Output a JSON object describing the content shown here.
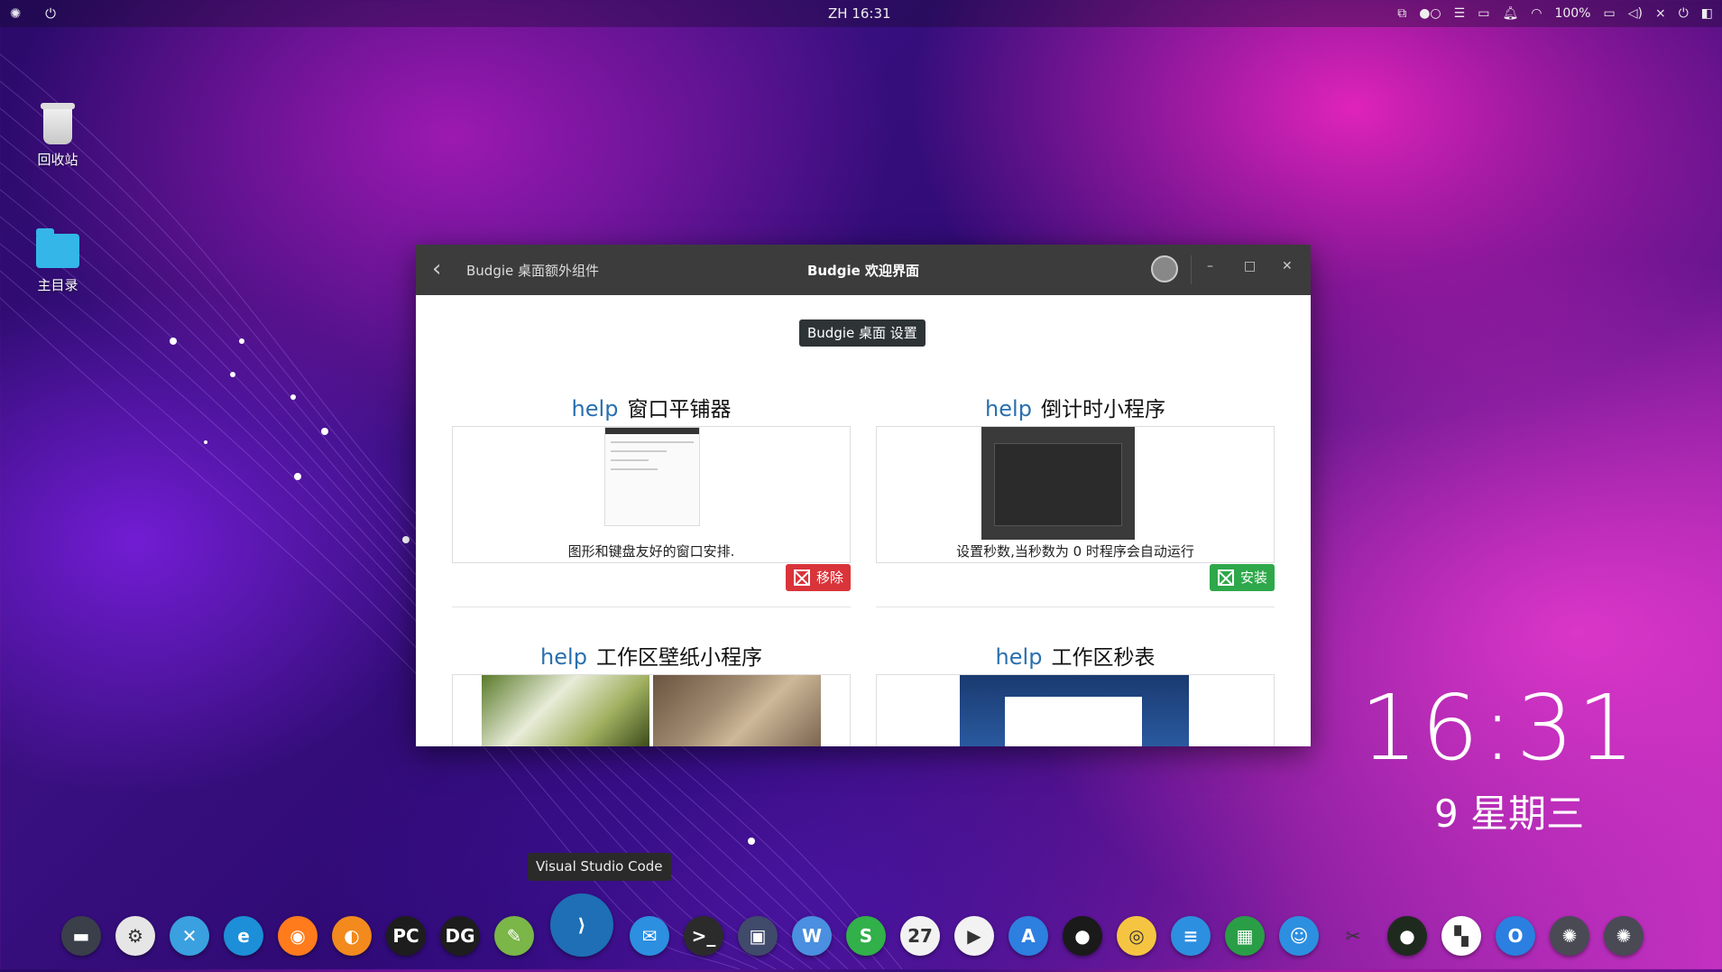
{
  "top_panel": {
    "clock": "ZH 16:31",
    "battery": "100%"
  },
  "desktop": {
    "trash_label": "回收站",
    "home_label": "主目录"
  },
  "window": {
    "breadcrumb": "Budgie 桌面额外组件",
    "title": "Budgie 欢迎界面",
    "settings_button": "Budgie 桌面 设置",
    "plugins": [
      {
        "help": "help",
        "name": "窗口平铺器",
        "desc": "图形和键盘友好的窗口安排.",
        "action": "移除"
      },
      {
        "help": "help",
        "name": "倒计时小程序",
        "desc": "设置秒数,当秒数为 0 时程序会自动运行",
        "action": "安装"
      },
      {
        "help": "help",
        "name": "工作区壁纸小程序",
        "desc": "",
        "action": ""
      },
      {
        "help": "help",
        "name": "工作区秒表",
        "desc": "",
        "action": ""
      }
    ]
  },
  "clock_widget": {
    "time": "16:31",
    "date": "9 星期三"
  },
  "tooltip": "Visual Studio Code",
  "dock": {
    "items": [
      {
        "name": "files",
        "glyph": "▬",
        "color": "#3a3f4a"
      },
      {
        "name": "settings",
        "glyph": "⚙",
        "color": "#e6e6e6"
      },
      {
        "name": "appstore-x",
        "glyph": "✕",
        "color": "#3aa0e0"
      },
      {
        "name": "edge",
        "glyph": "e",
        "color": "#1c8fd8"
      },
      {
        "name": "firefox",
        "glyph": "◉",
        "color": "#ff7b1c"
      },
      {
        "name": "anbox",
        "glyph": "◐",
        "color": "#f28a1e"
      },
      {
        "name": "pycharm",
        "glyph": "PC",
        "color": "#1d1d1d"
      },
      {
        "name": "datagrip",
        "glyph": "DG",
        "color": "#1d1d1d"
      },
      {
        "name": "notepadqq",
        "glyph": "✎",
        "color": "#7ab648"
      },
      {
        "name": "vscode",
        "glyph": "⟩",
        "color": "#1e6fb5"
      },
      {
        "name": "mail",
        "glyph": "✉",
        "color": "#2d8fe0"
      },
      {
        "name": "terminal",
        "glyph": ">_",
        "color": "#2b2b2b"
      },
      {
        "name": "screenshot",
        "glyph": "▣",
        "color": "#404a6a"
      },
      {
        "name": "writer",
        "glyph": "W",
        "color": "#4a8fe0"
      },
      {
        "name": "spreadsheet-s",
        "glyph": "S",
        "color": "#32b04a"
      },
      {
        "name": "calendar",
        "glyph": "27",
        "color": "#f2f2f2"
      },
      {
        "name": "player",
        "glyph": "▶",
        "color": "#f2f2f2"
      },
      {
        "name": "appstore",
        "glyph": "A",
        "color": "#2d7fe0"
      },
      {
        "name": "camera",
        "glyph": "●",
        "color": "#1a1a1a"
      },
      {
        "name": "cheese",
        "glyph": "◎",
        "color": "#f5c542"
      },
      {
        "name": "document-viewer",
        "glyph": "≡",
        "color": "#2d8fe0"
      },
      {
        "name": "calc",
        "glyph": "▦",
        "color": "#2a9e46"
      },
      {
        "name": "finder",
        "glyph": "☺",
        "color": "#2d8fe0"
      },
      {
        "name": "scissors",
        "glyph": "✂",
        "color": "transparent"
      },
      {
        "name": "green-orb",
        "glyph": "●",
        "color": "#1f2a1f"
      },
      {
        "name": "multitask",
        "glyph": "▚",
        "color": "#ffffff"
      },
      {
        "name": "o-app",
        "glyph": "O",
        "color": "#2a7fe0"
      },
      {
        "name": "budgie-menu",
        "glyph": "✺",
        "color": "#4a4a55"
      },
      {
        "name": "budgie-menu-2",
        "glyph": "✺",
        "color": "#4a4a55"
      }
    ]
  }
}
